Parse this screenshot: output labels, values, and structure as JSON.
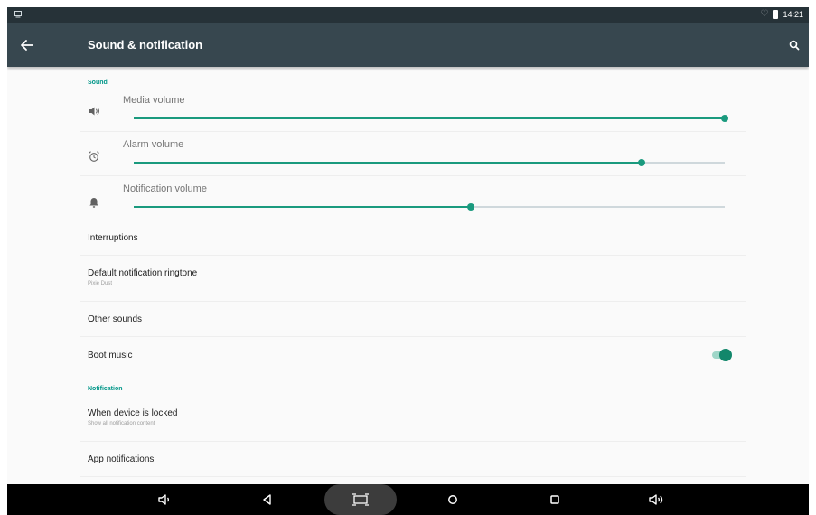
{
  "status_bar": {
    "time": "14:21"
  },
  "app_bar": {
    "title": "Sound & notification"
  },
  "sections": {
    "sound": "Sound",
    "notification": "Notification"
  },
  "volumes": [
    {
      "label": "Media volume",
      "icon": "speaker-icon",
      "level": 1.0
    },
    {
      "label": "Alarm volume",
      "icon": "alarm-icon",
      "level": 0.86
    },
    {
      "label": "Notification volume",
      "icon": "bell-icon",
      "level": 0.57
    }
  ],
  "items": {
    "interruptions": {
      "title": "Interruptions"
    },
    "ringtone": {
      "title": "Default notification ringtone",
      "summary": "Pixie Dust"
    },
    "other_sounds": {
      "title": "Other sounds"
    },
    "boot_music": {
      "title": "Boot music",
      "enabled": true
    },
    "locked": {
      "title": "When device is locked",
      "summary": "Show all notification content"
    },
    "app_notifications": {
      "title": "App notifications"
    }
  },
  "colors": {
    "accent": "#1a9a7e",
    "app_bar": "#37474f",
    "status_bar": "#263238",
    "nav_bar": "#000000"
  }
}
